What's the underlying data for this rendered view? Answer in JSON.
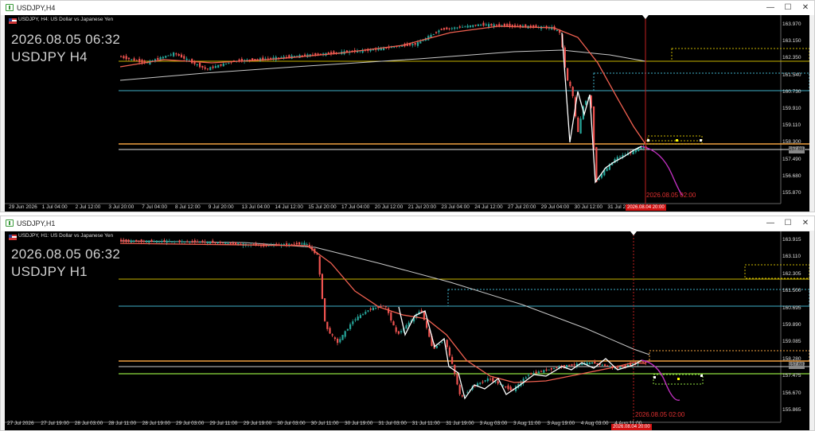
{
  "top": {
    "title": "USDJPY,H4",
    "symbol_line": "USDJPY, H4:  US Dollar vs Japanese Yen",
    "overlay_date": "2026.08.05 06:32",
    "overlay_pair": "USDJPY H4",
    "price_labels": [
      "163.970",
      "163.150",
      "162.350",
      "161.540",
      "160.730",
      "159.910",
      "159.110",
      "158.300",
      "157.490",
      "156.680",
      "155.870"
    ],
    "current_price": "157.687",
    "time_labels": [
      "29 Jun 2026",
      "1 Jul 04:00",
      "2 Jul 12:00",
      "3 Jul 20:00",
      "7 Jul 04:00",
      "8 Jul 12:00",
      "9 Jul 20:00",
      "13 Jul 04:00",
      "14 Jul 12:00",
      "15 Jul 20:00",
      "17 Jul 04:00",
      "20 Jul 12:00",
      "21 Jul 20:00",
      "23 Jul 04:00",
      "24 Jul 12:00",
      "27 Jul 20:00",
      "29 Jul 04:00",
      "30 Jul 12:00",
      "31 Jul 20:00"
    ],
    "cursor_time_label": "2026.08.04 20:00",
    "red_time_label": "2026.08.05 02:00"
  },
  "bottom": {
    "title": "USDJPY,H1",
    "symbol_line": "USDJPY, H1:  US Dollar vs Japanese Yen",
    "overlay_date": "2026.08.05 06:32",
    "overlay_pair": "USDJPY H1",
    "price_labels": [
      "163.915",
      "163.110",
      "162.305",
      "161.500",
      "160.695",
      "159.890",
      "159.085",
      "158.280",
      "157.475",
      "156.670",
      "155.865"
    ],
    "current_price": "157.687",
    "time_labels": [
      "27 Jul 2026",
      "27 Jul 19:00",
      "28 Jul 03:00",
      "28 Jul 11:00",
      "28 Jul 19:00",
      "29 Jul 03:00",
      "29 Jul 11:00",
      "29 Jul 19:00",
      "30 Jul 03:00",
      "30 Jul 11:00",
      "30 Jul 19:00",
      "31 Jul 03:00",
      "31 Jul 11:00",
      "31 Jul 19:00",
      "3 Aug 03:00",
      "3 Aug 11:00",
      "3 Aug 19:00",
      "4 Aug 03:00",
      "4 Aug 11:00"
    ],
    "cursor_time_label": "2026.08.04 20:00",
    "red_time_label": "2026.08.05 02:00"
  },
  "window_buttons": {
    "minimize": "—",
    "maximize": "☐",
    "close": "✕"
  },
  "colors": {
    "bull": "#26a69a",
    "bear": "#ef5350",
    "ma_fast": "#f06050",
    "ma_slow": "#c8c8c8",
    "forecast": "#c030c0",
    "zigzag": "#ffffff",
    "level_yellow": "#c8b400",
    "level_cyan": "#40b0c8",
    "level_orange": "#f0a040",
    "level_green": "#90e040"
  }
}
